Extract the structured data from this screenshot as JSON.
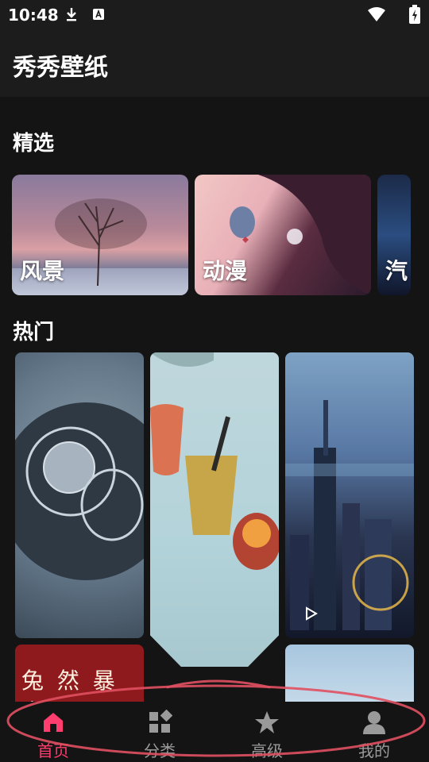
{
  "status": {
    "time": "10:48"
  },
  "app": {
    "title": "秀秀壁纸"
  },
  "sections": {
    "featured": "精选",
    "hot": "热门"
  },
  "categories": [
    {
      "label": "风景"
    },
    {
      "label": "动漫"
    },
    {
      "label": "汽"
    }
  ],
  "tiles": {
    "tile4_text": "兔 然 暴 富"
  },
  "nav": {
    "items": [
      {
        "label": "首页",
        "icon": "home-icon",
        "active": true
      },
      {
        "label": "分类",
        "icon": "grid-icon"
      },
      {
        "label": "高级",
        "icon": "star-icon"
      },
      {
        "label": "我的",
        "icon": "user-icon"
      }
    ],
    "active_color": "#ff3d6e",
    "inactive_color": "#9a9a9a"
  },
  "colors": {
    "background": "#141414",
    "appbar": "#1c1c1c",
    "annotation": "#e05060"
  }
}
